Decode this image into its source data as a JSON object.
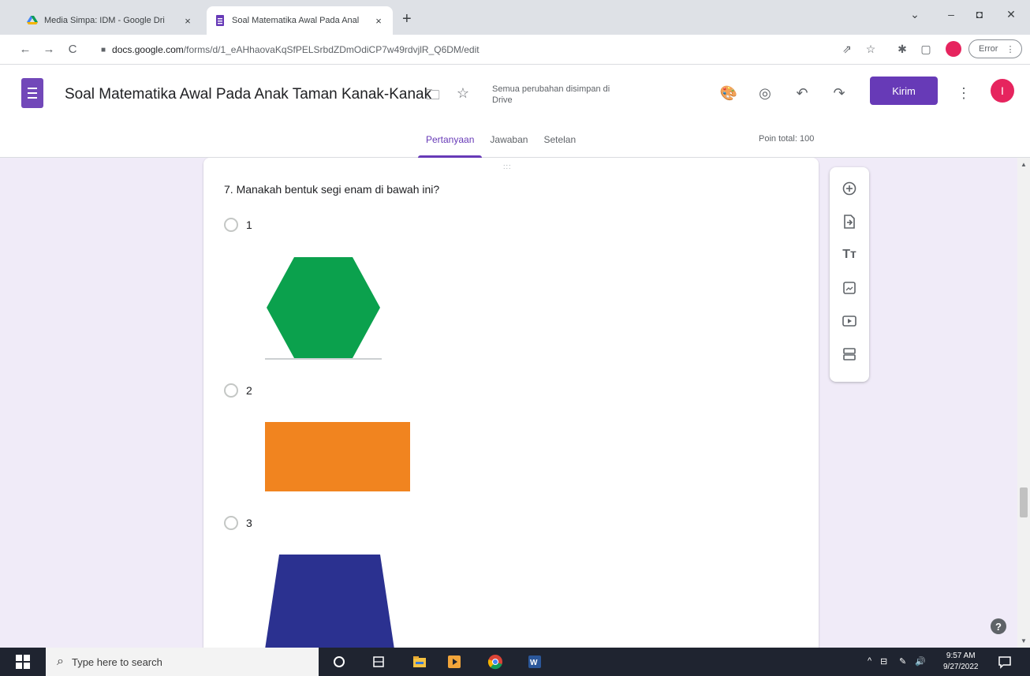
{
  "browser": {
    "tabs": [
      {
        "title": "Media Simpa: IDM - Google Dri",
        "close": "×",
        "active": false
      },
      {
        "title": "Soal Matematika Awal Pada Anal",
        "close": "×",
        "active": true
      }
    ],
    "new_tab": "+",
    "window_controls": {
      "dropdown": "⌄",
      "minimize": "–",
      "restore": "◘",
      "close": "✕"
    },
    "nav": {
      "back": "←",
      "forward": "→",
      "reload": "C"
    },
    "url_domain": "docs.google.com",
    "url_path": "/forms/d/1_eAHhaovaKqSfPELSrbdZDmOdiCP7w49rdvjlR_Q6DM/edit",
    "error_label": "Error",
    "error_dots": "⋮"
  },
  "header": {
    "title": "Soal Matematika Awal Pada Anak Taman Kanak-Kanak",
    "save_status": "Semua perubahan disimpan di Drive",
    "send_label": "Kirim",
    "avatar_letter": "I",
    "tabs": [
      {
        "label": "Pertanyaan",
        "active": true
      },
      {
        "label": "Jawaban",
        "active": false
      },
      {
        "label": "Setelan",
        "active": false
      }
    ],
    "points": "Poin total: 100"
  },
  "question": {
    "text": "7. Manakah bentuk segi enam di bawah ini?",
    "drag_handle": ":::",
    "options": [
      {
        "label": "1",
        "shape": "hexagon",
        "color": "#0ba14d"
      },
      {
        "label": "2",
        "shape": "rectangle",
        "color": "#f1841f"
      },
      {
        "label": "3",
        "shape": "trapezoid",
        "color": "#2b3190"
      }
    ]
  },
  "sidebar_icons": [
    "add-question-icon",
    "import-questions-icon",
    "add-title-icon",
    "add-image-icon",
    "add-video-icon",
    "add-section-icon"
  ],
  "help": "?",
  "taskbar": {
    "search_placeholder": "Type here to search",
    "time": "9:57 AM",
    "date": "9/27/2022"
  },
  "colors": {
    "forms_purple": "#673ab7",
    "background": "#f0ebf8",
    "avatar": "#e6245e"
  }
}
